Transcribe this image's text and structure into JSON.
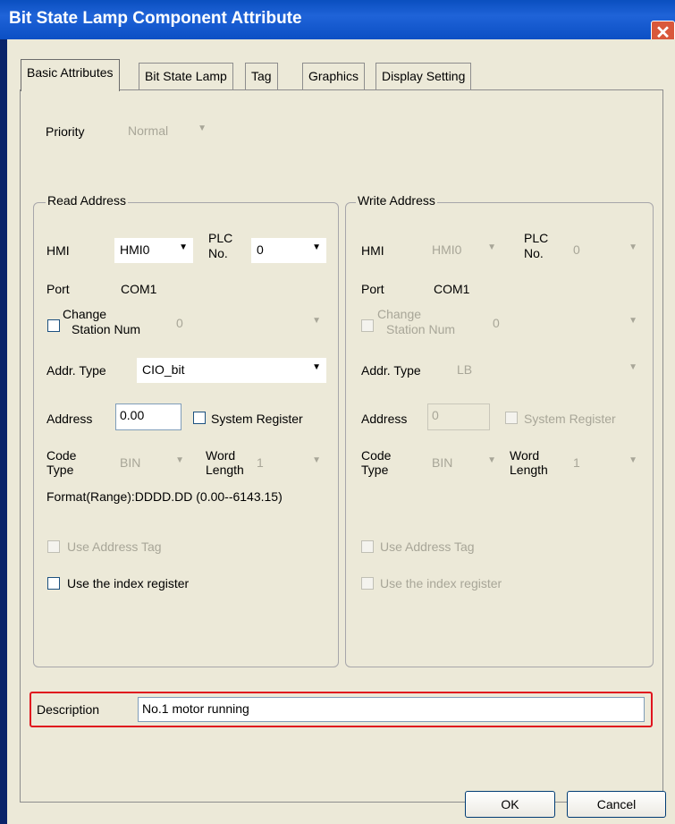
{
  "window": {
    "title": "Bit State Lamp Component Attribute",
    "close_glyph": "✕"
  },
  "tabs": [
    {
      "label": "Basic Attributes",
      "active": true
    },
    {
      "label": "Bit State Lamp"
    },
    {
      "label": "Tag"
    },
    {
      "label": "Graphics"
    },
    {
      "label": "Display Setting"
    }
  ],
  "priority": {
    "label": "Priority",
    "value": "Normal"
  },
  "read_address": {
    "group_title": "Read Address",
    "hmi_label": "HMI",
    "hmi_value": "HMI0",
    "plc_label_1": "PLC",
    "plc_label_2": "No.",
    "plc_value": "0",
    "port_label": "Port",
    "port_value": "COM1",
    "change_station_label_1": "Change",
    "change_station_label_2": "Station Num",
    "change_station_value": "0",
    "addr_type_label": "Addr. Type",
    "addr_type_value": "CIO_bit",
    "address_label": "Address",
    "address_value": "0.00",
    "system_register_label": "System Register",
    "code_type_label_1": "Code",
    "code_type_label_2": "Type",
    "code_type_value": "BIN",
    "word_length_label_1": "Word",
    "word_length_label_2": "Length",
    "word_length_value": "1",
    "format_text": "Format(Range):DDDD.DD (0.00--6143.15)",
    "use_address_tag_label": "Use Address Tag",
    "use_index_register_label": "Use the index register"
  },
  "write_address": {
    "group_title": "Write Address",
    "hmi_label": "HMI",
    "hmi_value": "HMI0",
    "plc_label_1": "PLC",
    "plc_label_2": "No.",
    "plc_value": "0",
    "port_label": "Port",
    "port_value": "COM1",
    "change_station_label_1": "Change",
    "change_station_label_2": "Station Num",
    "change_station_value": "0",
    "addr_type_label": "Addr. Type",
    "addr_type_value": "LB",
    "address_label": "Address",
    "address_value": "0",
    "system_register_label": "System Register",
    "code_type_label_1": "Code",
    "code_type_label_2": "Type",
    "code_type_value": "BIN",
    "word_length_label_1": "Word",
    "word_length_label_2": "Length",
    "word_length_value": "1",
    "use_address_tag_label": "Use Address Tag",
    "use_index_register_label": "Use the index register"
  },
  "description": {
    "label": "Description",
    "value": "No.1 motor running"
  },
  "buttons": {
    "ok": "OK",
    "cancel": "Cancel"
  },
  "icons": {
    "dropdown_arrow": "▼"
  },
  "colors": {
    "title_bar": "#0a4fbf",
    "highlight_border": "#e0141e",
    "dialog_bg": "#ece9d8"
  }
}
